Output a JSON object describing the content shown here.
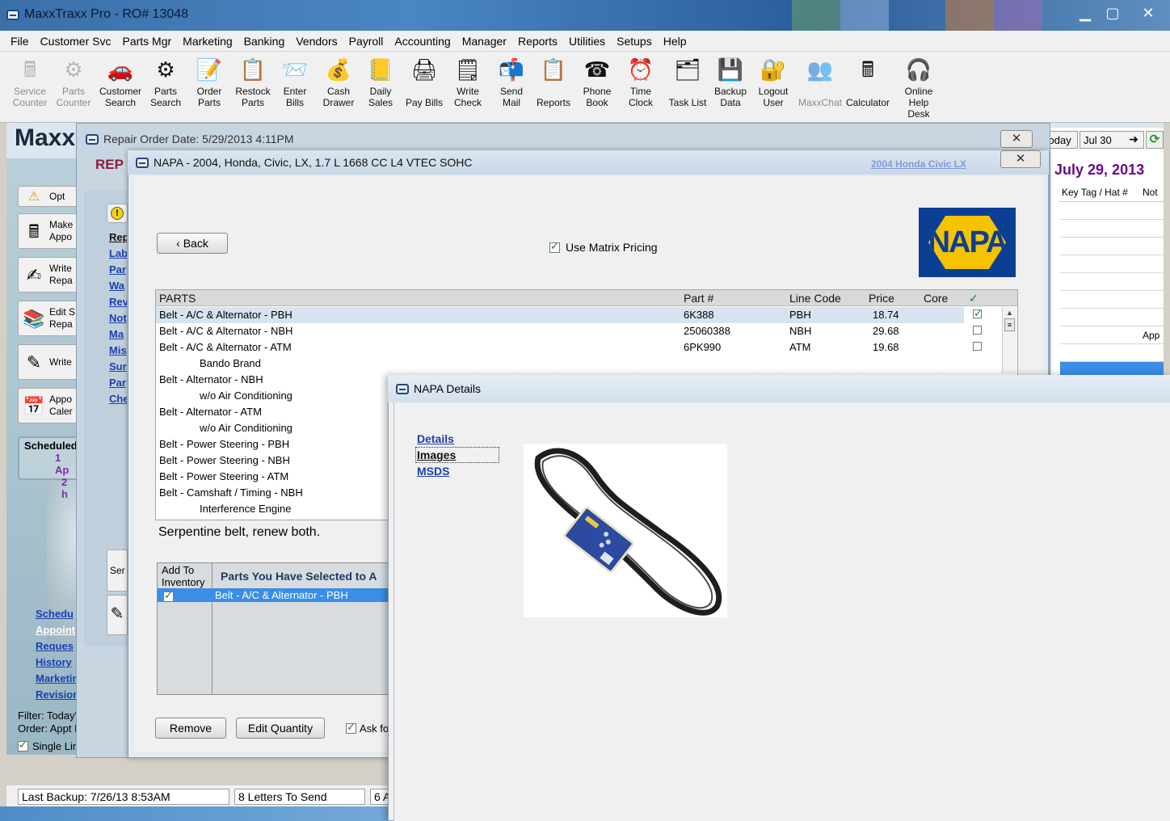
{
  "window": {
    "title": "MaxxTraxx Pro - RO# 13048"
  },
  "menu": [
    "File",
    "Customer Svc",
    "Parts Mgr",
    "Marketing",
    "Banking",
    "Vendors",
    "Payroll",
    "Accounting",
    "Manager",
    "Reports",
    "Utilities",
    "Setups",
    "Help"
  ],
  "toolbar": [
    {
      "label": "Service\nCounter",
      "icon": "service-counter-icon",
      "disabled": true
    },
    {
      "label": "Parts\nCounter",
      "icon": "parts-counter-icon",
      "disabled": true
    },
    {
      "label": "Customer\nSearch",
      "icon": "car-icon",
      "disabled": false
    },
    {
      "label": "Parts\nSearch",
      "icon": "gear-icon",
      "disabled": false
    },
    {
      "label": "Order\nParts",
      "icon": "order-icon",
      "disabled": false
    },
    {
      "label": "Restock\nParts",
      "icon": "restock-icon",
      "disabled": false
    },
    {
      "label": "Enter\nBills",
      "icon": "bills-icon",
      "disabled": false
    },
    {
      "label": "Cash\nDrawer",
      "icon": "money-bag-icon",
      "disabled": false
    },
    {
      "label": "Daily\nSales",
      "icon": "sales-icon",
      "disabled": false
    },
    {
      "label": "Pay Bills",
      "icon": "pay-bills-icon",
      "disabled": false
    },
    {
      "label": "Write\nCheck",
      "icon": "check-icon",
      "disabled": false
    },
    {
      "label": "Send\nMail",
      "icon": "mail-icon",
      "disabled": false
    },
    {
      "label": "Reports",
      "icon": "clipboard-icon",
      "disabled": false
    },
    {
      "label": "Phone\nBook",
      "icon": "phone-icon",
      "disabled": false
    },
    {
      "label": "Time\nClock",
      "icon": "clock-icon",
      "disabled": false
    },
    {
      "label": "Task List",
      "icon": "task-list-icon",
      "disabled": false
    },
    {
      "label": "Backup\nData",
      "icon": "floppy-icon",
      "disabled": false
    },
    {
      "label": "Logout\nUser",
      "icon": "logout-icon",
      "disabled": false
    },
    {
      "label": "MaxxChat",
      "icon": "chat-icon",
      "disabled": true
    },
    {
      "label": "Calculator",
      "icon": "calculator-icon",
      "disabled": false
    },
    {
      "label": "Online\nHelp\nDesk",
      "icon": "help-desk-icon",
      "disabled": false
    }
  ],
  "main": {
    "logo": "Maxx",
    "left_buttons": [
      "Opt",
      "Make\nAppo",
      "Write\nRepa",
      "Edit S\nRepa",
      "Write",
      "Appo\nCaler"
    ],
    "scheduled": {
      "title": "Scheduled",
      "line1": "1 Ap",
      "line2": "2 h"
    },
    "links": [
      "Schedu",
      "Appoint",
      "Reques",
      "History",
      "Marketing",
      "Revisions"
    ],
    "filter": "Filter: Today's Appts",
    "order": "Order: Appt Date",
    "single_line": "Single Line Schedule",
    "status": {
      "last_backup": "Last Backup:  7/26/13   8:53AM",
      "letters": "8 Letters To Send",
      "other": "6 A"
    }
  },
  "calendar": {
    "today": "Today",
    "date": "Jul 30",
    "heading": "y  July 29, 2013",
    "col1": "Key Tag / Hat #",
    "col2": "Not",
    "appt_fragment": "App"
  },
  "repair_order": {
    "title": "Repair Order Date:  5/29/2013    4:11PM",
    "rep": "REP",
    "side_links": [
      "Rep",
      "Lab",
      "Par",
      "Wa",
      "Rev",
      "Not",
      "Ma",
      "Mis",
      "Sur",
      "Par",
      "Che"
    ],
    "ser_fragment": "Ser"
  },
  "napa": {
    "title": "NAPA - 2004, Honda, Civic, LX, 1.7 L 1668 CC L4 VTEC SOHC",
    "vehicle_link": "2004 Honda  Civic LX",
    "back": "‹ Back",
    "matrix_label": "Use Matrix Pricing",
    "matrix_checked": true,
    "logo_text": "NAPA",
    "columns": {
      "parts": "PARTS",
      "part_no": "Part #",
      "line_code": "Line Code",
      "price": "Price",
      "core": "Core",
      "check": "✓"
    },
    "rows": [
      {
        "desc": "Belt - A/C & Alternator - PBH",
        "part": "6K388",
        "line": "PBH",
        "price": "18.74",
        "checked": true,
        "selected": true
      },
      {
        "desc": "Belt - A/C & Alternator - NBH",
        "part": "25060388",
        "line": "NBH",
        "price": "29.68",
        "checked": false
      },
      {
        "desc": "Belt - A/C & Alternator - ATM",
        "part": "6PK990",
        "line": "ATM",
        "price": "19.68",
        "checked": false
      },
      {
        "desc": "Bando Brand",
        "indent": true
      },
      {
        "desc": "Belt - Alternator - NBH"
      },
      {
        "desc": "w/o Air Conditioning",
        "indent": true
      },
      {
        "desc": "Belt - Alternator - ATM"
      },
      {
        "desc": "w/o Air Conditioning",
        "indent": true
      },
      {
        "desc": "Belt - Power Steering - PBH"
      },
      {
        "desc": "Belt - Power Steering - NBH"
      },
      {
        "desc": "Belt - Power Steering - ATM"
      },
      {
        "desc": "Belt - Camshaft / Timing - NBH"
      },
      {
        "desc": "Interference Engine",
        "indent": true
      }
    ],
    "note": "Serpentine belt, renew both.",
    "selected_parts": {
      "add_header": "Add To\nInventory",
      "header": "Parts You Have Selected to A",
      "row": "Belt - A/C & Alternator - PBH"
    },
    "remove": "Remove",
    "edit_qty": "Edit Quantity",
    "ask": "Ask fo"
  },
  "details": {
    "title": "NAPA Details",
    "links": [
      "Details",
      "Images",
      "MSDS"
    ],
    "image_alt": "serpentine-belt-image"
  },
  "colors": {
    "title_blue": "#3b6fa8",
    "napa_blue": "#0b3f94",
    "napa_yellow": "#f5c300",
    "link_blue": "#1a3fb0",
    "selection_blue": "#3a8ee6"
  }
}
